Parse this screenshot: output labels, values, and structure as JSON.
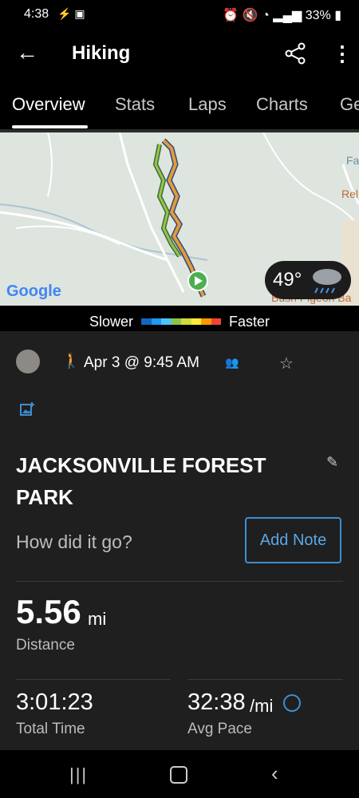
{
  "status_bar": {
    "time": "4:38",
    "battery": "33%"
  },
  "app_bar": {
    "title": "Hiking"
  },
  "tabs": [
    {
      "label": "Overview"
    },
    {
      "label": "Stats"
    },
    {
      "label": "Laps"
    },
    {
      "label": "Charts"
    },
    {
      "label": "Ge"
    }
  ],
  "map": {
    "provider_logo": "Google",
    "weather": {
      "temp": "49°"
    },
    "places": [
      "Fa",
      "Rel",
      "Bush Pigeon Ba"
    ]
  },
  "pace_legend": {
    "slower": "Slower",
    "faster": "Faster",
    "colors": [
      "#1565c0",
      "#2196f3",
      "#4fc3f7",
      "#8bc34a",
      "#cddc39",
      "#ffeb3b",
      "#ff9800",
      "#f44336"
    ]
  },
  "activity": {
    "date": "Apr 3 @ 9:45 AM",
    "name": "JACKSONVILLE FOREST PARK",
    "prompt": "How did it go?",
    "add_note": "Add Note"
  },
  "stats": {
    "distance": {
      "value": "5.56",
      "unit": "mi",
      "label": "Distance"
    },
    "total_time": {
      "value": "3:01:23",
      "label": "Total Time"
    },
    "avg_pace": {
      "value": "32:38",
      "unit": "/mi",
      "label": "Avg Pace"
    }
  },
  "colors": {
    "accent": "#3e8ed0",
    "background": "#1f1f1f"
  }
}
